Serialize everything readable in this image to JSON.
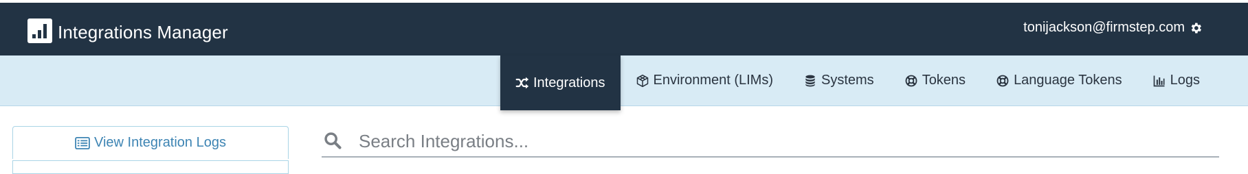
{
  "header": {
    "app_title": "Integrations Manager",
    "user_email": "tonijackson@firmstep.com",
    "background_color": "#223344"
  },
  "nav": {
    "items": [
      {
        "label": "Integrations",
        "icon": "shuffle-icon",
        "active": true
      },
      {
        "label": "Environment (LIMs)",
        "icon": "cube-icon",
        "active": false
      },
      {
        "label": "Systems",
        "icon": "database-icon",
        "active": false
      },
      {
        "label": "Tokens",
        "icon": "life-ring-icon",
        "active": false
      },
      {
        "label": "Language Tokens",
        "icon": "life-ring-icon",
        "active": false
      },
      {
        "label": "Logs",
        "icon": "bar-chart-icon",
        "active": false
      }
    ],
    "background_color": "#d8ebf5"
  },
  "sidebar": {
    "view_logs_label": "View Integration Logs",
    "icon": "list-alt-icon"
  },
  "search": {
    "placeholder": "Search Integrations...",
    "value": ""
  }
}
